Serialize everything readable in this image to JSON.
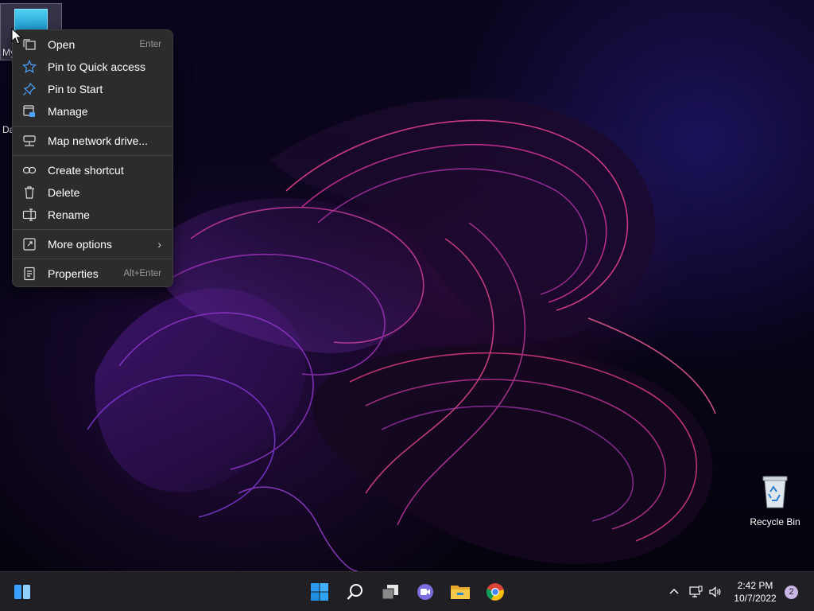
{
  "desktop": {
    "icons": {
      "this_pc_label": "My",
      "partial_label": "Da",
      "recycle_bin_label": "Recycle Bin"
    }
  },
  "context_menu": {
    "items": [
      {
        "label": "Open",
        "shortcut": "Enter",
        "icon": "open-icon"
      },
      {
        "label": "Pin to Quick access",
        "icon": "star-icon"
      },
      {
        "label": "Pin to Start",
        "icon": "pin-icon"
      },
      {
        "label": "Manage",
        "icon": "manage-icon"
      },
      {
        "label": "Map network drive...",
        "icon": "network-drive-icon"
      },
      {
        "label": "Create shortcut",
        "icon": "link-icon"
      },
      {
        "label": "Delete",
        "icon": "trash-icon"
      },
      {
        "label": "Rename",
        "icon": "rename-icon"
      },
      {
        "label": "More options",
        "icon": "more-options-icon"
      },
      {
        "label": "Properties",
        "shortcut": "Alt+Enter",
        "icon": "properties-icon"
      }
    ]
  },
  "taskbar": {
    "apps": [
      "widgets-icon",
      "start-icon",
      "search-icon",
      "task-view-icon",
      "teams-chat-icon",
      "file-explorer-icon",
      "chrome-icon"
    ],
    "clock": {
      "time": "2:42 PM",
      "date": "10/7/2022"
    },
    "notification_count": "2"
  },
  "colors": {
    "menu_bg": "#2c2c2c",
    "taskbar_bg": "#1f1f24",
    "accent_blue": "#3aa0ff"
  }
}
